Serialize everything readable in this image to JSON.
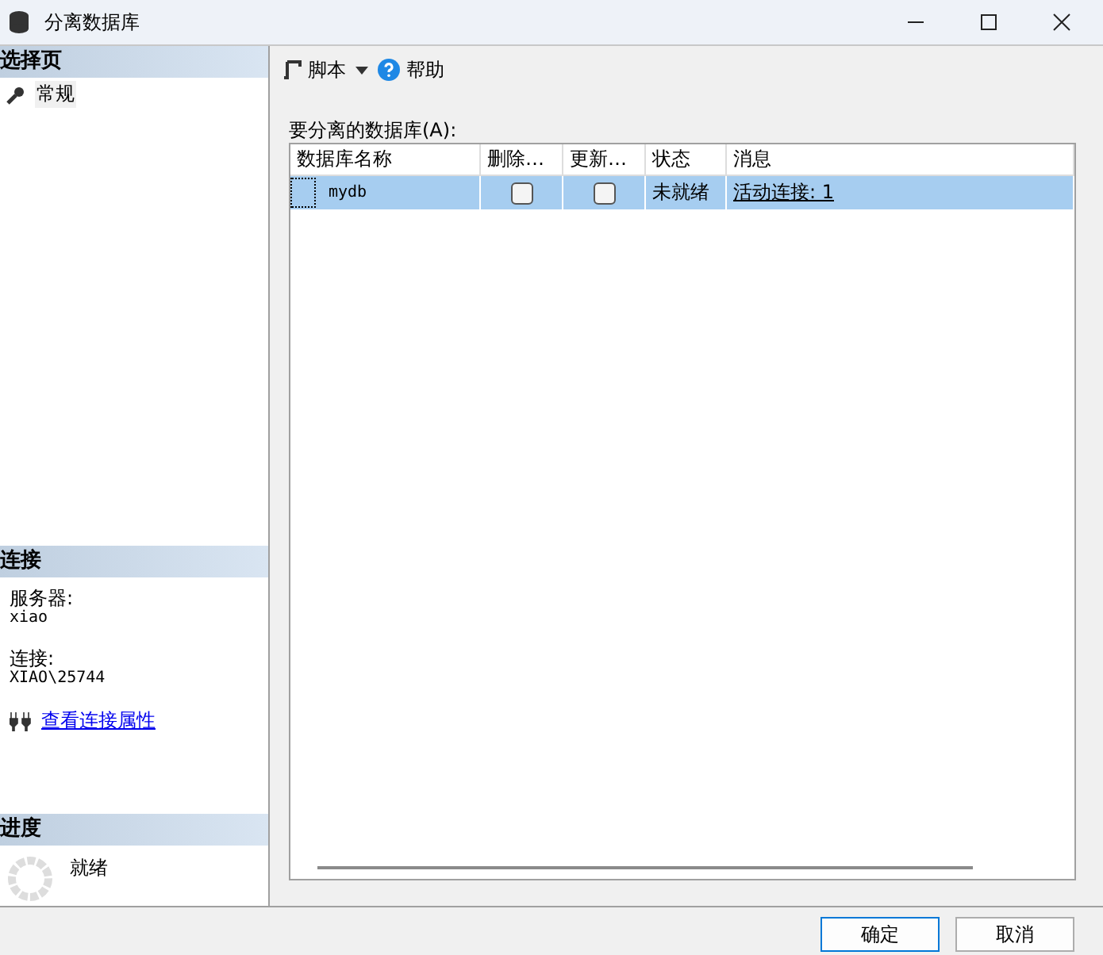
{
  "window": {
    "title": "分离数据库"
  },
  "sidebar": {
    "select_page": {
      "heading": "选择页",
      "items": [
        {
          "label": "常规",
          "selected": true
        }
      ]
    },
    "connection": {
      "heading": "连接",
      "server_label": "服务器:",
      "server": "xiao",
      "connection_label": "连接:",
      "connection": "XIAO\\25744",
      "link": "查看连接属性"
    },
    "progress": {
      "heading": "进度",
      "status": "就绪"
    }
  },
  "toolbar": {
    "script": "脚本",
    "help": "帮助"
  },
  "table": {
    "label": "要分离的数据库(A):",
    "columns": [
      "数据库名称",
      "删除…",
      "更新…",
      "状态",
      "消息"
    ],
    "rows": [
      {
        "name": "mydb",
        "drop": false,
        "update": false,
        "status": "未就绪",
        "message": "活动连接: 1",
        "selected": true
      }
    ]
  },
  "buttons": [
    "确定",
    "取消"
  ]
}
